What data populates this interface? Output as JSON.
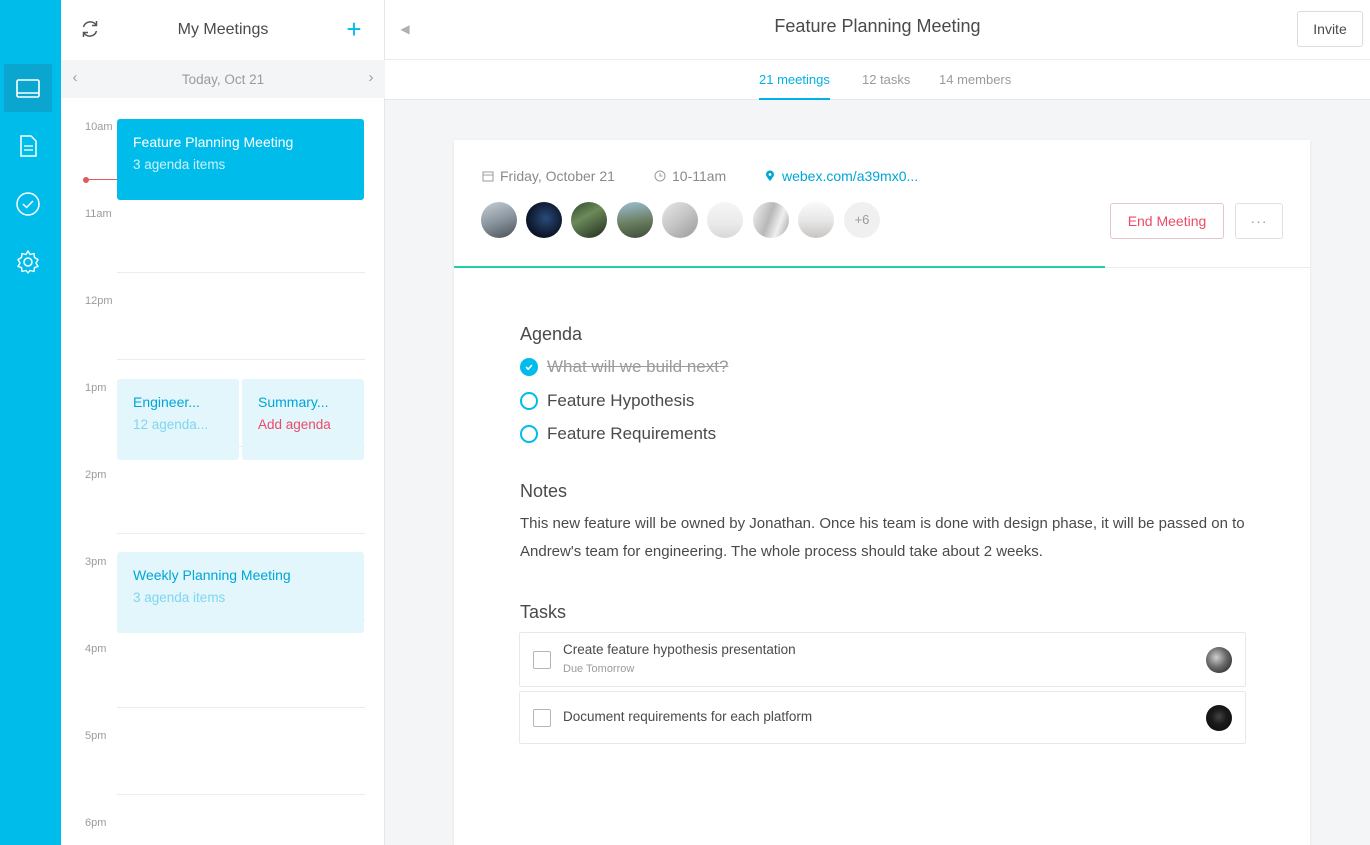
{
  "rail": {
    "items": [
      {
        "icon": "calendar-icon",
        "active": true
      },
      {
        "icon": "document-icon",
        "active": false
      },
      {
        "icon": "check-circle-icon",
        "active": false
      },
      {
        "icon": "gear-icon",
        "active": false
      }
    ]
  },
  "meetings_panel": {
    "title": "My Meetings",
    "add_label": "+",
    "date": "Today, Oct 21",
    "hours": [
      "10am",
      "11am",
      "12pm",
      "1pm",
      "2pm",
      "3pm",
      "4pm",
      "5pm",
      "6pm"
    ],
    "events": [
      {
        "title": "Feature Planning Meeting",
        "subtitle": "3 agenda items"
      },
      {
        "title": "Engineer...",
        "subtitle": "12 agenda..."
      },
      {
        "title": "Summary...",
        "subtitle": "Add agenda"
      },
      {
        "title": "Weekly Planning Meeting",
        "subtitle": "3 agenda items"
      }
    ]
  },
  "header": {
    "title": "Feature Planning Meeting",
    "invite_label": "Invite"
  },
  "tabs": [
    {
      "label": "21 meetings",
      "active": true
    },
    {
      "label": "12 tasks",
      "active": false
    },
    {
      "label": "14 members",
      "active": false
    }
  ],
  "meeting": {
    "date": "Friday, October 21",
    "time": "10-11am",
    "link": "webex.com/a39mx0...",
    "more_members": "+6",
    "end_label": "End Meeting",
    "more_label": "···",
    "progress": 0.76
  },
  "agenda": {
    "title": "Agenda",
    "items": [
      {
        "label": "What will we build next?",
        "done": true
      },
      {
        "label": "Feature Hypothesis",
        "done": false
      },
      {
        "label": "Feature Requirements",
        "done": false
      }
    ]
  },
  "notes": {
    "title": "Notes",
    "text": "This new feature will be owned by Jonathan. Once his team is done with design phase, it will be passed on to Andrew's team for engineering. The whole process should take about 2 weeks."
  },
  "tasks": {
    "title": "Tasks",
    "items": [
      {
        "label": "Create feature hypothesis presentation",
        "due": "Due Tomorrow"
      },
      {
        "label": "Document requirements for each platform",
        "due": ""
      }
    ]
  },
  "colors": {
    "accent": "#00bceb",
    "danger": "#ed4a6a",
    "progress": "#1ed1a8"
  }
}
